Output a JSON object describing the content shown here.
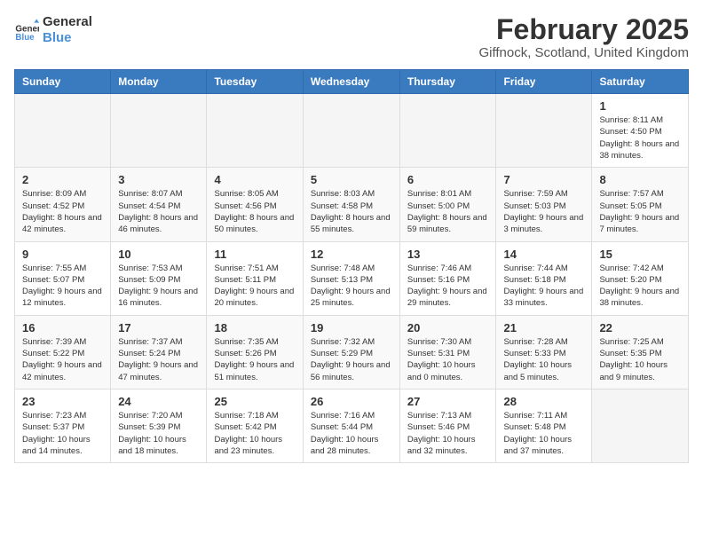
{
  "logo": {
    "text_general": "General",
    "text_blue": "Blue"
  },
  "title": "February 2025",
  "subtitle": "Giffnock, Scotland, United Kingdom",
  "weekdays": [
    "Sunday",
    "Monday",
    "Tuesday",
    "Wednesday",
    "Thursday",
    "Friday",
    "Saturday"
  ],
  "weeks": [
    [
      {
        "day": "",
        "info": ""
      },
      {
        "day": "",
        "info": ""
      },
      {
        "day": "",
        "info": ""
      },
      {
        "day": "",
        "info": ""
      },
      {
        "day": "",
        "info": ""
      },
      {
        "day": "",
        "info": ""
      },
      {
        "day": "1",
        "info": "Sunrise: 8:11 AM\nSunset: 4:50 PM\nDaylight: 8 hours and 38 minutes."
      }
    ],
    [
      {
        "day": "2",
        "info": "Sunrise: 8:09 AM\nSunset: 4:52 PM\nDaylight: 8 hours and 42 minutes."
      },
      {
        "day": "3",
        "info": "Sunrise: 8:07 AM\nSunset: 4:54 PM\nDaylight: 8 hours and 46 minutes."
      },
      {
        "day": "4",
        "info": "Sunrise: 8:05 AM\nSunset: 4:56 PM\nDaylight: 8 hours and 50 minutes."
      },
      {
        "day": "5",
        "info": "Sunrise: 8:03 AM\nSunset: 4:58 PM\nDaylight: 8 hours and 55 minutes."
      },
      {
        "day": "6",
        "info": "Sunrise: 8:01 AM\nSunset: 5:00 PM\nDaylight: 8 hours and 59 minutes."
      },
      {
        "day": "7",
        "info": "Sunrise: 7:59 AM\nSunset: 5:03 PM\nDaylight: 9 hours and 3 minutes."
      },
      {
        "day": "8",
        "info": "Sunrise: 7:57 AM\nSunset: 5:05 PM\nDaylight: 9 hours and 7 minutes."
      }
    ],
    [
      {
        "day": "9",
        "info": "Sunrise: 7:55 AM\nSunset: 5:07 PM\nDaylight: 9 hours and 12 minutes."
      },
      {
        "day": "10",
        "info": "Sunrise: 7:53 AM\nSunset: 5:09 PM\nDaylight: 9 hours and 16 minutes."
      },
      {
        "day": "11",
        "info": "Sunrise: 7:51 AM\nSunset: 5:11 PM\nDaylight: 9 hours and 20 minutes."
      },
      {
        "day": "12",
        "info": "Sunrise: 7:48 AM\nSunset: 5:13 PM\nDaylight: 9 hours and 25 minutes."
      },
      {
        "day": "13",
        "info": "Sunrise: 7:46 AM\nSunset: 5:16 PM\nDaylight: 9 hours and 29 minutes."
      },
      {
        "day": "14",
        "info": "Sunrise: 7:44 AM\nSunset: 5:18 PM\nDaylight: 9 hours and 33 minutes."
      },
      {
        "day": "15",
        "info": "Sunrise: 7:42 AM\nSunset: 5:20 PM\nDaylight: 9 hours and 38 minutes."
      }
    ],
    [
      {
        "day": "16",
        "info": "Sunrise: 7:39 AM\nSunset: 5:22 PM\nDaylight: 9 hours and 42 minutes."
      },
      {
        "day": "17",
        "info": "Sunrise: 7:37 AM\nSunset: 5:24 PM\nDaylight: 9 hours and 47 minutes."
      },
      {
        "day": "18",
        "info": "Sunrise: 7:35 AM\nSunset: 5:26 PM\nDaylight: 9 hours and 51 minutes."
      },
      {
        "day": "19",
        "info": "Sunrise: 7:32 AM\nSunset: 5:29 PM\nDaylight: 9 hours and 56 minutes."
      },
      {
        "day": "20",
        "info": "Sunrise: 7:30 AM\nSunset: 5:31 PM\nDaylight: 10 hours and 0 minutes."
      },
      {
        "day": "21",
        "info": "Sunrise: 7:28 AM\nSunset: 5:33 PM\nDaylight: 10 hours and 5 minutes."
      },
      {
        "day": "22",
        "info": "Sunrise: 7:25 AM\nSunset: 5:35 PM\nDaylight: 10 hours and 9 minutes."
      }
    ],
    [
      {
        "day": "23",
        "info": "Sunrise: 7:23 AM\nSunset: 5:37 PM\nDaylight: 10 hours and 14 minutes."
      },
      {
        "day": "24",
        "info": "Sunrise: 7:20 AM\nSunset: 5:39 PM\nDaylight: 10 hours and 18 minutes."
      },
      {
        "day": "25",
        "info": "Sunrise: 7:18 AM\nSunset: 5:42 PM\nDaylight: 10 hours and 23 minutes."
      },
      {
        "day": "26",
        "info": "Sunrise: 7:16 AM\nSunset: 5:44 PM\nDaylight: 10 hours and 28 minutes."
      },
      {
        "day": "27",
        "info": "Sunrise: 7:13 AM\nSunset: 5:46 PM\nDaylight: 10 hours and 32 minutes."
      },
      {
        "day": "28",
        "info": "Sunrise: 7:11 AM\nSunset: 5:48 PM\nDaylight: 10 hours and 37 minutes."
      },
      {
        "day": "",
        "info": ""
      }
    ]
  ]
}
